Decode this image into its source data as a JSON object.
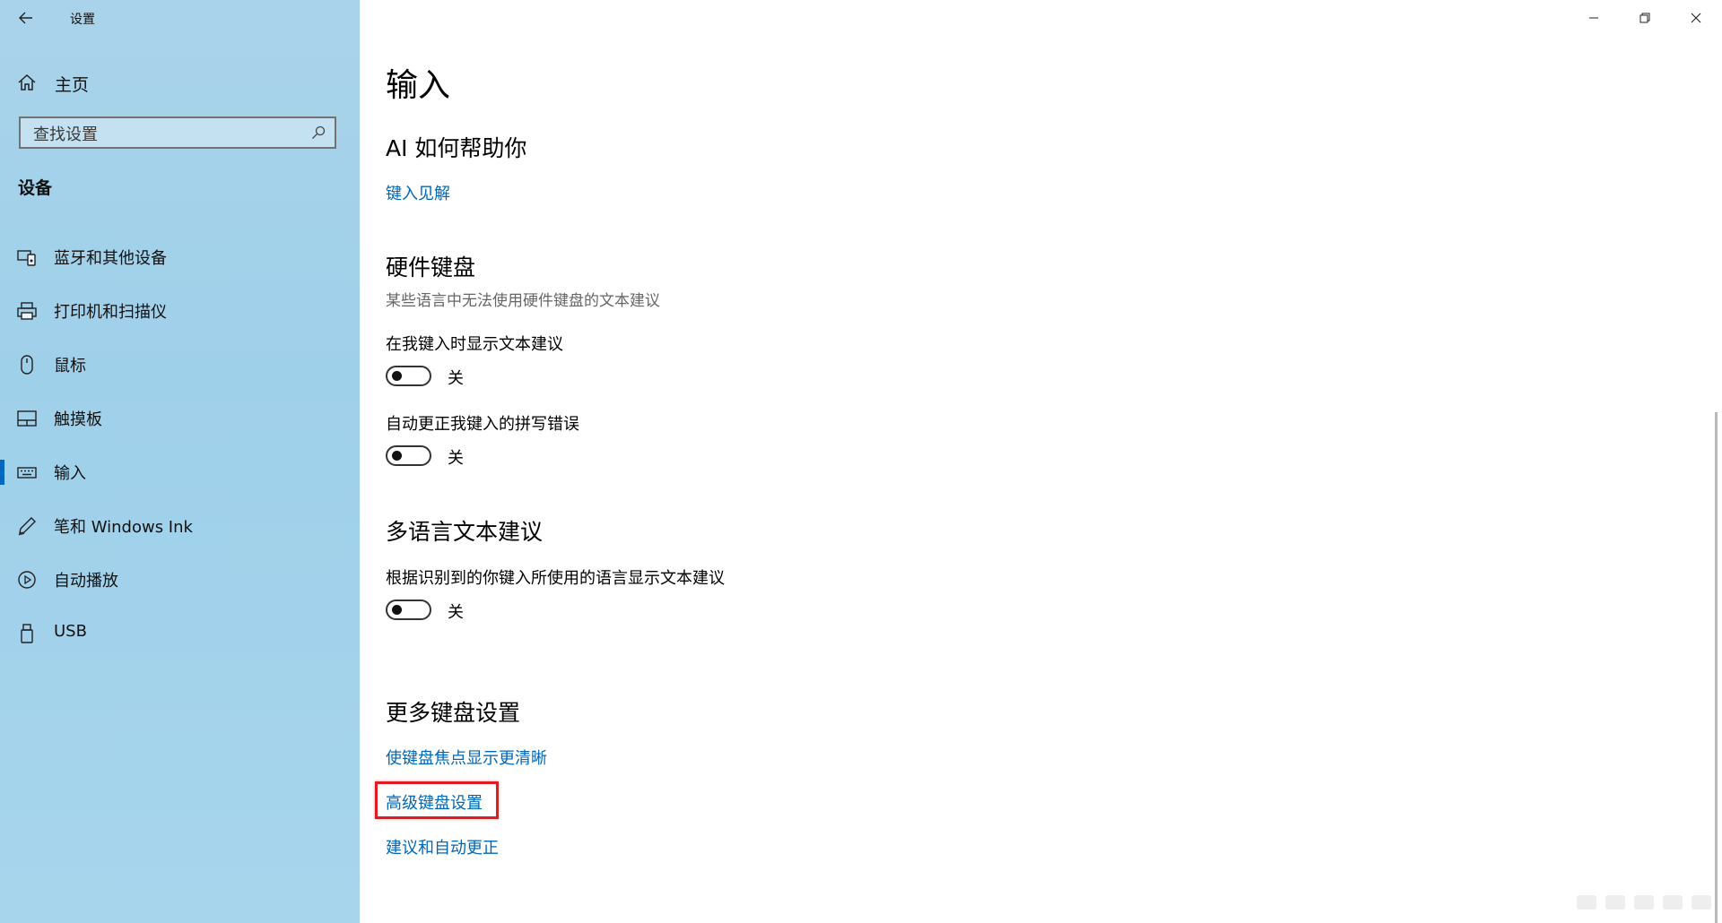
{
  "app": {
    "title": "设置"
  },
  "sidebar": {
    "home_label": "主页",
    "search_placeholder": "查找设置",
    "section_heading": "设备",
    "items": [
      {
        "label": "蓝牙和其他设备",
        "icon": "bluetooth-devices-icon"
      },
      {
        "label": "打印机和扫描仪",
        "icon": "printer-icon"
      },
      {
        "label": "鼠标",
        "icon": "mouse-icon"
      },
      {
        "label": "触摸板",
        "icon": "touchpad-icon"
      },
      {
        "label": "输入",
        "icon": "keyboard-icon",
        "active": true
      },
      {
        "label": "笔和 Windows Ink",
        "icon": "pen-icon"
      },
      {
        "label": "自动播放",
        "icon": "autoplay-icon"
      },
      {
        "label": "USB",
        "icon": "usb-icon"
      }
    ]
  },
  "main": {
    "page_title": "输入",
    "ai_section": {
      "heading": "AI 如何帮助你",
      "link": "键入见解"
    },
    "hardware_keyboard": {
      "heading": "硬件键盘",
      "description": "某些语言中无法使用硬件键盘的文本建议",
      "settings": [
        {
          "label": "在我键入时显示文本建议",
          "state": "关"
        },
        {
          "label": "自动更正我键入的拼写错误",
          "state": "关"
        }
      ]
    },
    "multilingual": {
      "heading": "多语言文本建议",
      "setting": {
        "label": "根据识别到的你键入所使用的语言显示文本建议",
        "state": "关"
      }
    },
    "more_keyboard": {
      "heading": "更多键盘设置",
      "links": [
        "使键盘焦点显示更清晰",
        "高级键盘设置",
        "建议和自动更正"
      ]
    }
  },
  "colors": {
    "accent": "#0067b8",
    "highlight": "#e01b24",
    "sidebar_bg": "#a9d3ea"
  }
}
